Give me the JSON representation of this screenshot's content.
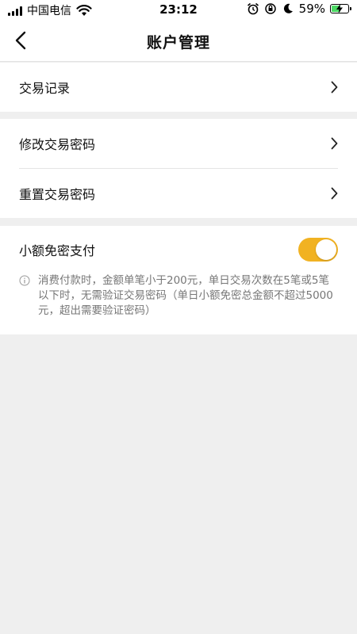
{
  "status_bar": {
    "carrier": "中国电信",
    "time": "23:12",
    "battery_percent": "59%",
    "battery_level": 0.59,
    "icons": [
      "signal-icon",
      "wifi-icon",
      "alarm-icon",
      "orientation-lock-icon",
      "moon-icon",
      "battery-charging-icon"
    ]
  },
  "nav": {
    "title": "账户管理",
    "back_icon": "chevron-left-icon"
  },
  "groups": [
    {
      "items": [
        {
          "label": "交易记录",
          "icon": "chevron-right-icon"
        }
      ]
    },
    {
      "items": [
        {
          "label": "修改交易密码",
          "icon": "chevron-right-icon"
        },
        {
          "label": "重置交易密码",
          "icon": "chevron-right-icon"
        }
      ]
    },
    {
      "toggle": {
        "label": "小额免密支付",
        "on": true,
        "color": "#f1b222"
      },
      "note": {
        "icon": "info-icon",
        "text": "消费付款时，金额单笔小于200元，单日交易次数在5笔或5笔以下时，无需验证交易密码（单日小额免密总金额不超过5000元，超出需要验证密码）"
      }
    }
  ],
  "colors": {
    "background": "#efefef",
    "accent": "#f1b222",
    "battery_fill": "#4cd964"
  }
}
